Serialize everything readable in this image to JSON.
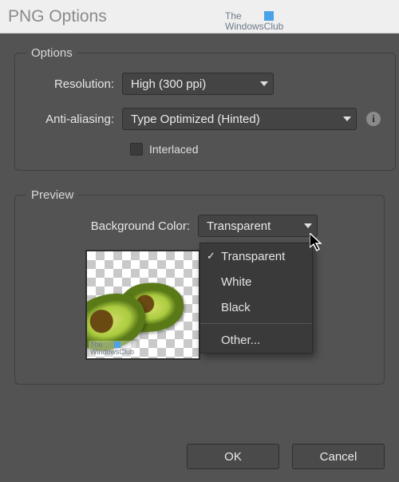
{
  "window": {
    "title": "PNG Options"
  },
  "watermark": {
    "line1": "The",
    "line2": "WindowsClub"
  },
  "options": {
    "legend": "Options",
    "resolution_label": "Resolution:",
    "resolution_value": "High (300 ppi)",
    "aa_label": "Anti-aliasing:",
    "aa_value": "Type Optimized (Hinted)",
    "interlaced_label": "Interlaced",
    "interlaced_checked": false
  },
  "preview": {
    "legend": "Preview",
    "bgcolor_label": "Background Color:",
    "bgcolor_value": "Transparent",
    "menu": {
      "items": [
        "Transparent",
        "White",
        "Black"
      ],
      "other": "Other...",
      "selected": "Transparent"
    }
  },
  "buttons": {
    "ok": "OK",
    "cancel": "Cancel"
  }
}
